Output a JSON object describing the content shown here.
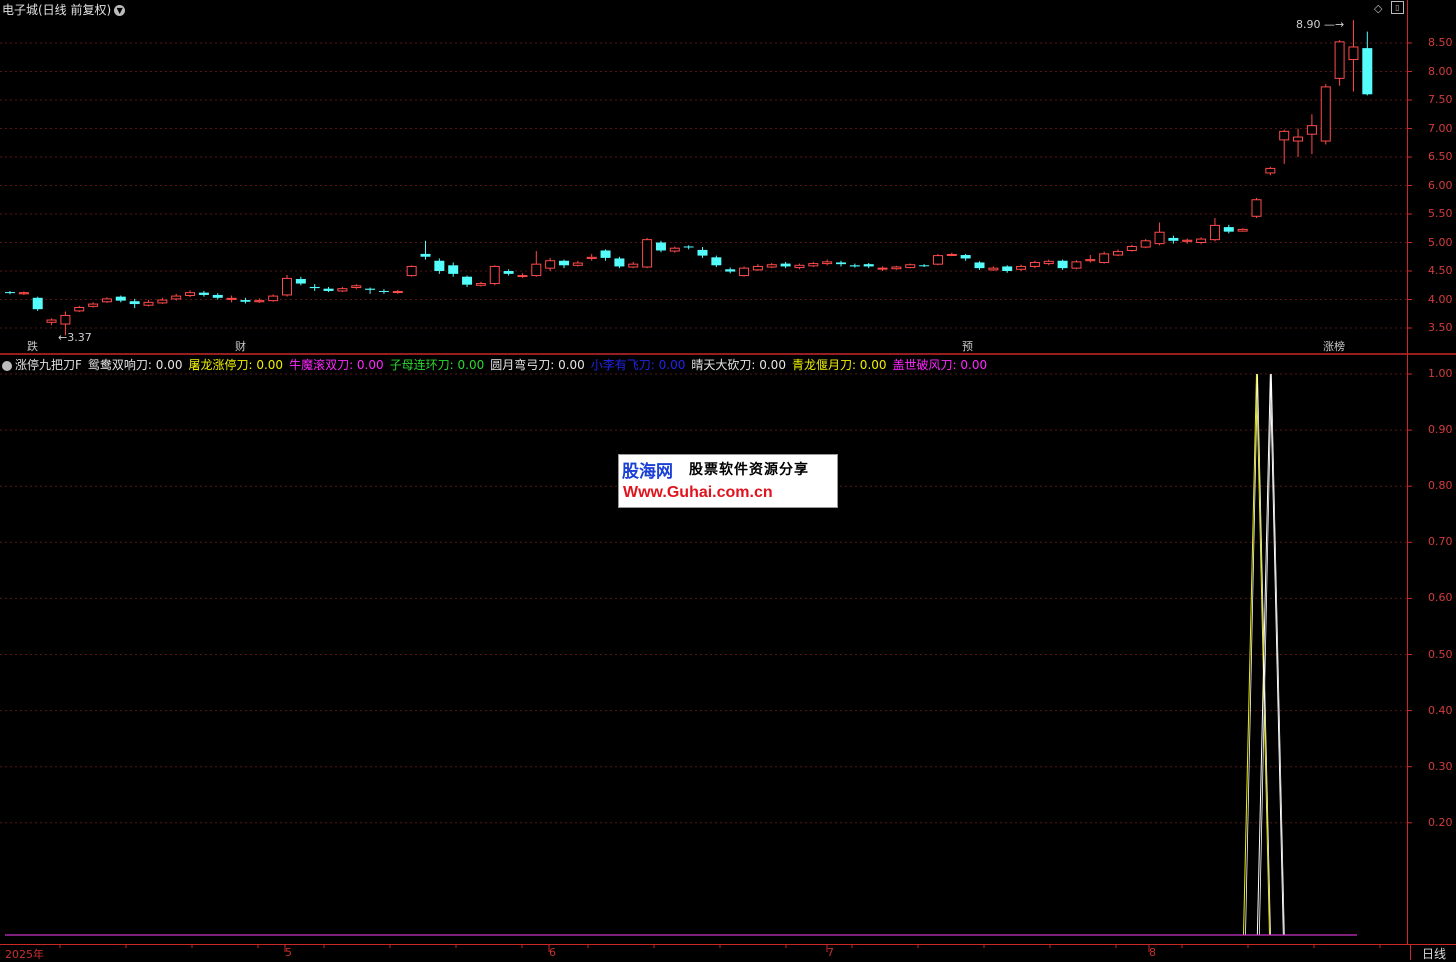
{
  "window": {
    "stock_title": "电子城(日线 前复权)",
    "collapse_icon": "chevron-down-icon",
    "buttons": [
      "diamond-icon",
      "restore-icon"
    ]
  },
  "colors": {
    "up": "#ff4a4a",
    "down": "#54fcfc",
    "axis": "#c82828",
    "grid": "#5a1616"
  },
  "price_axis": {
    "ticks": [
      "8.50",
      "8.00",
      "7.50",
      "7.00",
      "6.50",
      "6.00",
      "5.50",
      "5.00",
      "4.50",
      "4.00",
      "3.50"
    ],
    "range": [
      3.2,
      9.0
    ]
  },
  "price_markers": {
    "high": "8.90",
    "low": "3.37"
  },
  "event_markers": [
    {
      "label": "跌",
      "color": "#1b8f2b"
    },
    {
      "label": "财",
      "color": "#3a6be0"
    },
    {
      "label": "预",
      "color": "#d88a1a"
    },
    {
      "label": "涨榜",
      "color": "#d83a3a"
    }
  ],
  "candles": [
    [
      4.13,
      4.12,
      4.15,
      4.09
    ],
    [
      4.1,
      4.12,
      4.14,
      4.08
    ],
    [
      4.03,
      3.83,
      4.05,
      3.8
    ],
    [
      3.6,
      3.64,
      3.67,
      3.55
    ],
    [
      3.57,
      3.72,
      3.79,
      3.37
    ],
    [
      3.8,
      3.86,
      3.89,
      3.78
    ],
    [
      3.88,
      3.92,
      3.95,
      3.86
    ],
    [
      3.96,
      4.01,
      4.04,
      3.94
    ],
    [
      4.05,
      3.98,
      4.07,
      3.95
    ],
    [
      3.97,
      3.92,
      4.01,
      3.85
    ],
    [
      3.9,
      3.95,
      3.99,
      3.88
    ],
    [
      3.94,
      3.99,
      4.03,
      3.92
    ],
    [
      4.01,
      4.06,
      4.1,
      3.98
    ],
    [
      4.07,
      4.12,
      4.16,
      4.04
    ],
    [
      4.12,
      4.08,
      4.15,
      4.05
    ],
    [
      4.08,
      4.03,
      4.11,
      4.0
    ],
    [
      4.01,
      4.02,
      4.07,
      3.95
    ],
    [
      3.99,
      3.96,
      4.03,
      3.93
    ],
    [
      3.96,
      3.98,
      4.02,
      3.94
    ],
    [
      3.98,
      4.06,
      4.09,
      3.96
    ],
    [
      4.08,
      4.37,
      4.43,
      4.05
    ],
    [
      4.36,
      4.28,
      4.4,
      4.25
    ],
    [
      4.22,
      4.2,
      4.27,
      4.15
    ],
    [
      4.19,
      4.15,
      4.22,
      4.13
    ],
    [
      4.15,
      4.19,
      4.22,
      4.13
    ],
    [
      4.21,
      4.24,
      4.27,
      4.18
    ],
    [
      4.19,
      4.17,
      4.21,
      4.1
    ],
    [
      4.15,
      4.14,
      4.18,
      4.1
    ],
    [
      4.13,
      4.14,
      4.17,
      4.1
    ],
    [
      4.42,
      4.58,
      4.6,
      4.4
    ],
    [
      4.8,
      4.75,
      5.03,
      4.7
    ],
    [
      4.68,
      4.5,
      4.72,
      4.45
    ],
    [
      4.6,
      4.45,
      4.65,
      4.4
    ],
    [
      4.4,
      4.26,
      4.42,
      4.22
    ],
    [
      4.25,
      4.28,
      4.31,
      4.23
    ],
    [
      4.28,
      4.58,
      4.6,
      4.25
    ],
    [
      4.5,
      4.45,
      4.53,
      4.42
    ],
    [
      4.41,
      4.42,
      4.46,
      4.38
    ],
    [
      4.42,
      4.62,
      4.85,
      4.4
    ],
    [
      4.55,
      4.68,
      4.73,
      4.5
    ],
    [
      4.68,
      4.6,
      4.7,
      4.55
    ],
    [
      4.6,
      4.64,
      4.68,
      4.58
    ],
    [
      4.72,
      4.74,
      4.8,
      4.68
    ],
    [
      4.86,
      4.73,
      4.88,
      4.68
    ],
    [
      4.72,
      4.58,
      4.75,
      4.55
    ],
    [
      4.57,
      4.62,
      4.66,
      4.55
    ],
    [
      4.57,
      5.05,
      5.08,
      4.55
    ],
    [
      5.0,
      4.86,
      5.03,
      4.83
    ],
    [
      4.85,
      4.9,
      4.93,
      4.82
    ],
    [
      4.93,
      4.92,
      4.95,
      4.88
    ],
    [
      4.87,
      4.77,
      4.92,
      4.73
    ],
    [
      4.74,
      4.6,
      4.77,
      4.57
    ],
    [
      4.53,
      4.49,
      4.56,
      4.46
    ],
    [
      4.42,
      4.55,
      4.58,
      4.4
    ],
    [
      4.52,
      4.58,
      4.62,
      4.5
    ],
    [
      4.57,
      4.61,
      4.64,
      4.55
    ],
    [
      4.63,
      4.58,
      4.66,
      4.55
    ],
    [
      4.56,
      4.6,
      4.63,
      4.53
    ],
    [
      4.59,
      4.63,
      4.66,
      4.57
    ],
    [
      4.63,
      4.66,
      4.7,
      4.6
    ],
    [
      4.65,
      4.62,
      4.68,
      4.58
    ],
    [
      4.6,
      4.58,
      4.63,
      4.56
    ],
    [
      4.62,
      4.58,
      4.64,
      4.55
    ],
    [
      4.54,
      4.55,
      4.58,
      4.5
    ],
    [
      4.54,
      4.57,
      4.59,
      4.52
    ],
    [
      4.56,
      4.61,
      4.63,
      4.55
    ],
    [
      4.6,
      4.59,
      4.62,
      4.57
    ],
    [
      4.62,
      4.77,
      4.8,
      4.6
    ],
    [
      4.78,
      4.79,
      4.82,
      4.76
    ],
    [
      4.78,
      4.72,
      4.8,
      4.68
    ],
    [
      4.65,
      4.55,
      4.67,
      4.52
    ],
    [
      4.52,
      4.55,
      4.58,
      4.5
    ],
    [
      4.58,
      4.5,
      4.6,
      4.47
    ],
    [
      4.53,
      4.58,
      4.61,
      4.5
    ],
    [
      4.58,
      4.65,
      4.68,
      4.55
    ],
    [
      4.63,
      4.67,
      4.7,
      4.6
    ],
    [
      4.68,
      4.55,
      4.7,
      4.52
    ],
    [
      4.55,
      4.66,
      4.69,
      4.53
    ],
    [
      4.68,
      4.7,
      4.78,
      4.65
    ],
    [
      4.65,
      4.8,
      4.84,
      4.63
    ],
    [
      4.78,
      4.84,
      4.88,
      4.76
    ],
    [
      4.86,
      4.93,
      4.96,
      4.84
    ],
    [
      4.92,
      5.03,
      5.06,
      4.9
    ],
    [
      4.98,
      5.18,
      5.35,
      4.95
    ],
    [
      5.08,
      5.03,
      5.12,
      4.98
    ],
    [
      5.02,
      5.04,
      5.07,
      4.98
    ],
    [
      5.0,
      5.06,
      5.09,
      4.97
    ],
    [
      5.05,
      5.3,
      5.43,
      5.02
    ],
    [
      5.27,
      5.19,
      5.31,
      5.16
    ],
    [
      5.2,
      5.23,
      5.25,
      5.19
    ],
    [
      5.46,
      5.75,
      5.78,
      5.43
    ],
    [
      6.22,
      6.3,
      6.33,
      6.18
    ],
    [
      6.8,
      6.95,
      6.98,
      6.38
    ],
    [
      6.78,
      6.85,
      7.0,
      6.5
    ],
    [
      6.9,
      7.05,
      7.25,
      6.55
    ],
    [
      6.78,
      7.73,
      7.78,
      6.72
    ],
    [
      7.88,
      8.52,
      8.55,
      7.75
    ],
    [
      8.21,
      8.43,
      8.9,
      7.65
    ],
    [
      8.41,
      7.6,
      8.7,
      7.58
    ]
  ],
  "indicator": {
    "name": "涨停九把刀F",
    "legend": [
      {
        "label": "鸳鸯双响刀: 0.00",
        "color": "#e6e6e6"
      },
      {
        "label": "屠龙涨停刀: 0.00",
        "color": "#f0f000"
      },
      {
        "label": "牛魔滚双刀: 0.00",
        "color": "#ff28ff"
      },
      {
        "label": "子母连环刀: 0.00",
        "color": "#2cd82c"
      },
      {
        "label": "圆月弯弓刀: 0.00",
        "color": "#e6e6e6"
      },
      {
        "label": "小李有飞刀: 0.00",
        "color": "#2424e6"
      },
      {
        "label": "晴天大砍刀: 0.00",
        "color": "#e6e6e6"
      },
      {
        "label": "青龙偃月刀: 0.00",
        "color": "#f0f000"
      },
      {
        "label": "盖世破风刀: 0.00",
        "color": "#ff28ff"
      }
    ],
    "axis_ticks": [
      "1.00",
      "0.90",
      "0.80",
      "0.70",
      "0.60",
      "0.50",
      "0.40",
      "0.30",
      "0.20"
    ],
    "spikes": [
      {
        "index": 90,
        "value": 1.0,
        "colors": [
          "#f0f000",
          "#ffffff"
        ]
      },
      {
        "index": 91,
        "value": 1.0,
        "colors": [
          "#ffffff",
          "#ffffff"
        ]
      }
    ]
  },
  "time_axis": {
    "labels": [
      "2025年",
      "5",
      "6",
      "7",
      "8"
    ]
  },
  "watermark": {
    "site": "股海网",
    "slogan": "股票软件资源分享",
    "url": "Www.Guhai.com.cn"
  },
  "period_tab": "日线"
}
